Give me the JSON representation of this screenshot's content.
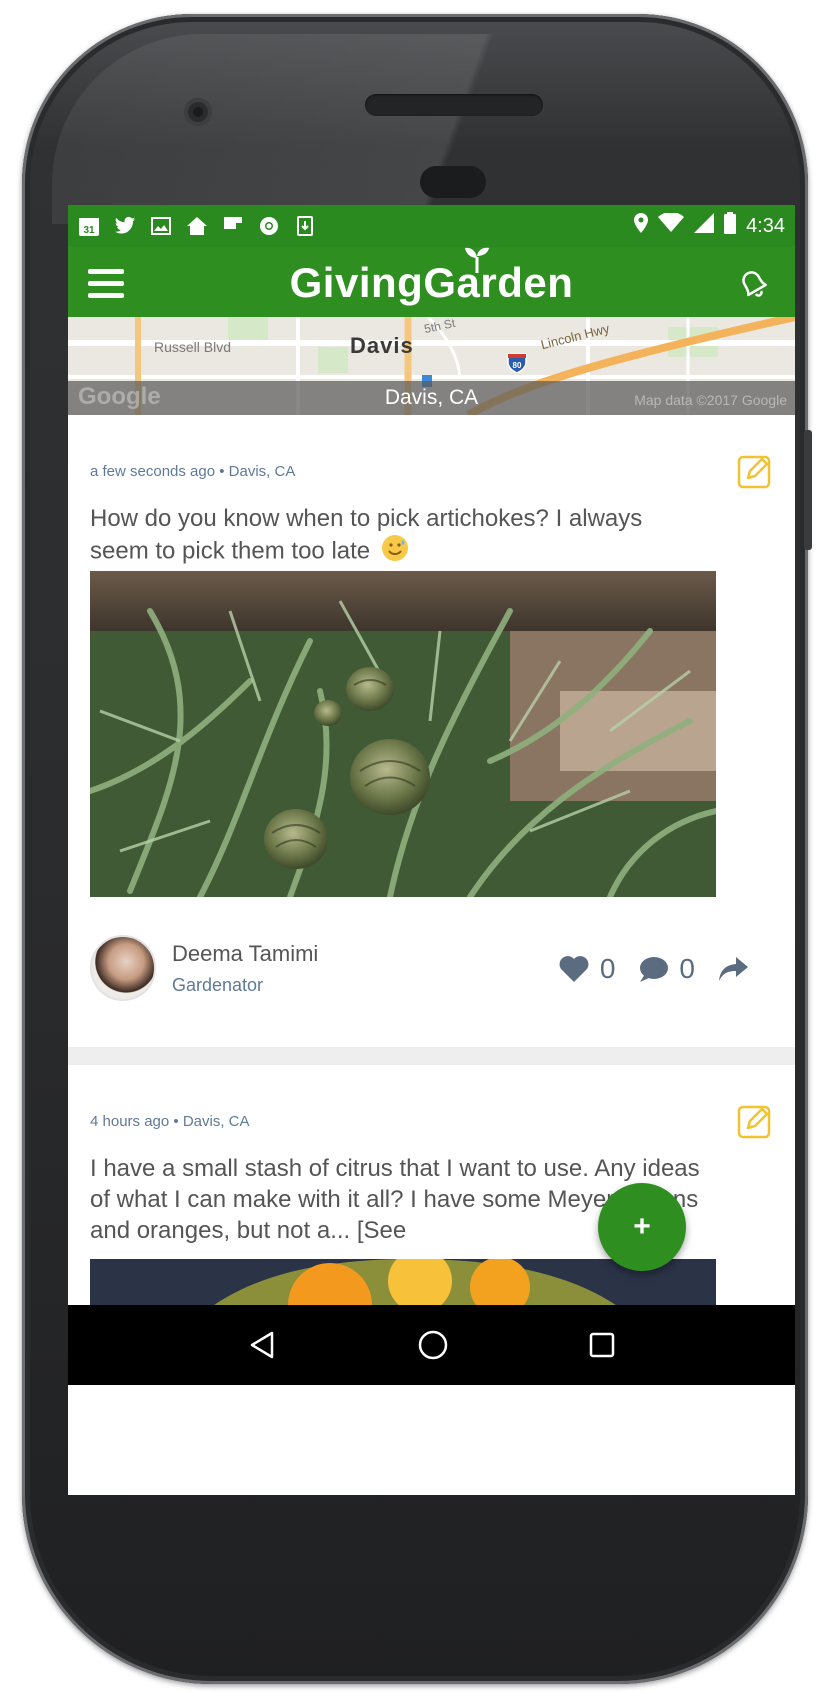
{
  "status_bar": {
    "time": "4:34",
    "left_icons": [
      "calendar-icon",
      "twitter-icon",
      "image-icon",
      "home-icon",
      "flipboard-icon",
      "chrome-icon",
      "download-icon"
    ],
    "calendar_day": "31"
  },
  "app_bar": {
    "title": "GivingGarden"
  },
  "map": {
    "location_label": "Davis, CA",
    "city_label": "Davis",
    "street_1": "Russell Blvd",
    "street_2": "5th St",
    "highway": "Lincoln Hwy",
    "interstate": "80",
    "google_logo": "Google",
    "credit": "Map data ©2017 Google"
  },
  "posts": [
    {
      "meta": "a few seconds ago • Davis, CA",
      "text": "How do you know when to pick artichokes? I always seem to pick them too late",
      "author_name": "Deema Tamimi",
      "author_role": "Gardenator",
      "likes": "0",
      "comments": "0"
    },
    {
      "meta": "4 hours ago • Davis, CA",
      "text": "I have a small stash of citrus that I want to use. Any ideas of what I can make with it all? I have some Meyer lemons and oranges, but not a... [See"
    }
  ],
  "fab_label": "+",
  "colors": {
    "brand_green": "#2e8f20",
    "status_green": "#2a8a1f",
    "meta_blue": "#5f7a99",
    "edit_yellow": "#f2c230"
  }
}
